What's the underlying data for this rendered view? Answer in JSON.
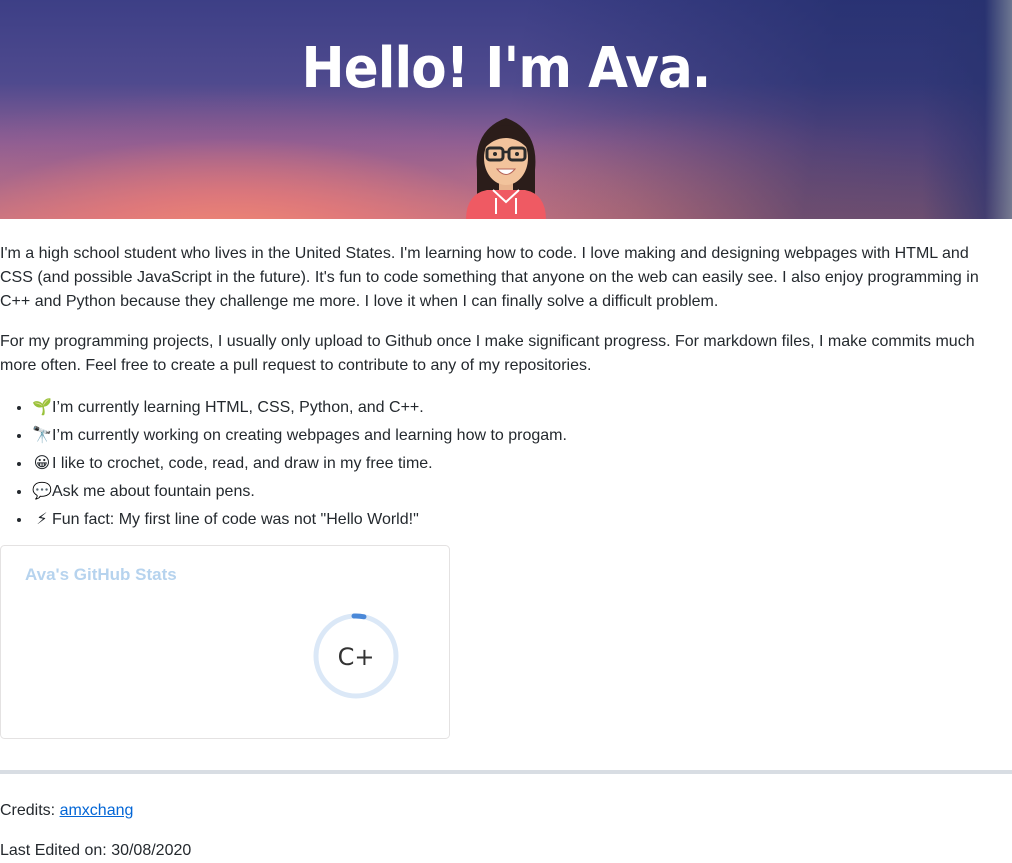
{
  "banner": {
    "title": "Hello! I'm Ava."
  },
  "about": {
    "paragraph1": "I'm a high school student who lives in the United States. I'm learning how to code. I love making and designing webpages with HTML and CSS (and possible JavaScript in the future). It's fun to code something that anyone on the web can easily see. I also enjoy programming in C++ and Python because they challenge me more. I love it when I can finally solve a difficult problem.",
    "paragraph2": "For my programming projects, I usually only upload to Github once I make significant progress. For markdown files, I make commits much more often. Feel free to create a pull request to contribute to any of my repositories."
  },
  "facts": [
    {
      "icon": "seedling-icon",
      "glyph": "🌱",
      "text": "I’m currently learning HTML, CSS, Python, and C++."
    },
    {
      "icon": "telescope-icon",
      "glyph": "🔭",
      "text": "I’m currently working on creating webpages and learning how to progam."
    },
    {
      "icon": "smile-icon",
      "glyph": "😀",
      "text": "I like to crochet, code, read, and draw in my free time."
    },
    {
      "icon": "speech-bubble-icon",
      "glyph": "💬",
      "text": "Ask me about fountain pens."
    },
    {
      "icon": "lightning-icon",
      "glyph": "⚡",
      "text": "Fun fact: My first line of code was not \"Hello World!\""
    }
  ],
  "stats": {
    "title": "Ava's GitHub Stats",
    "grade": "C+",
    "ring_color": "#dbe8f7",
    "progress_color": "#4a88d8",
    "title_color": "#b6d3ee"
  },
  "footer": {
    "credits_label": "Credits: ",
    "credits_link": "amxchang",
    "last_edited": "Last Edited on: 30/08/2020"
  },
  "colors": {
    "link": "#0366d6",
    "text": "#24292e"
  }
}
